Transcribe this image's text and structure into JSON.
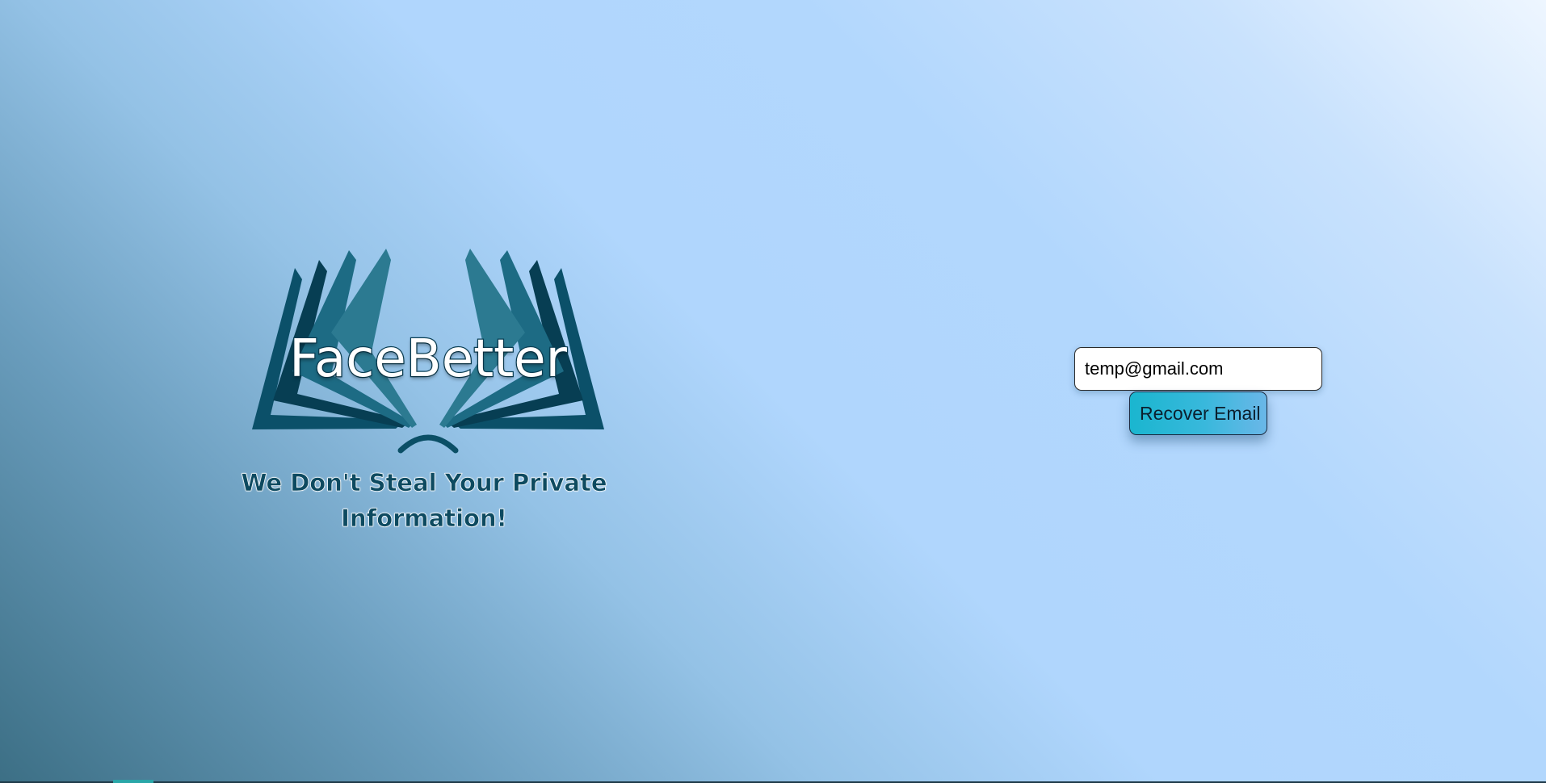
{
  "brand": {
    "name": "FaceBetter",
    "tagline": "We Don't Steal Your Private Information!",
    "logo_icon": "open-book-icon"
  },
  "recover": {
    "email_value": "temp@gmail.com",
    "button_label": "Recover Email"
  },
  "colors": {
    "logo_primary": "#0b4f66",
    "logo_dark": "#053a4d",
    "logo_light": "#2b7088",
    "button_start": "#1ab6cf",
    "button_end": "#6ab7e8",
    "background_light": "#b2d7fd",
    "background_dark": "#3c6f85"
  }
}
